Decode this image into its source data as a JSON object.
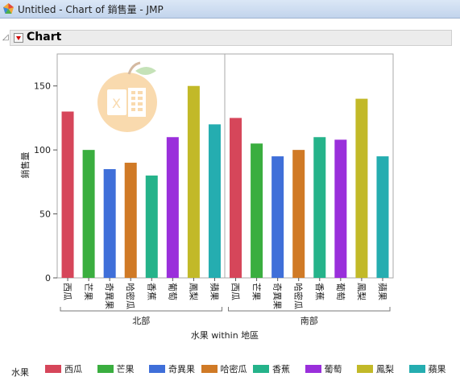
{
  "window": {
    "title": "Untitled - Chart of 銷售量 - JMP"
  },
  "outline": {
    "title": "Chart"
  },
  "chart_data": {
    "type": "bar",
    "ylabel": "銷售量",
    "xlabel": "水果 within 地區",
    "ylim": [
      0,
      175
    ],
    "yticks": [
      0,
      50,
      100,
      150
    ],
    "groups": [
      {
        "name": "北部",
        "categories": [
          "西瓜",
          "芒果",
          "奇異果",
          "哈密瓜",
          "香蕉",
          "葡萄",
          "鳳梨",
          "蘋果"
        ],
        "values": [
          130,
          100,
          85,
          90,
          80,
          110,
          150,
          120
        ]
      },
      {
        "name": "南部",
        "categories": [
          "西瓜",
          "芒果",
          "奇異果",
          "哈密瓜",
          "香蕉",
          "葡萄",
          "鳳梨",
          "蘋果"
        ],
        "values": [
          125,
          105,
          95,
          100,
          110,
          108,
          140,
          95
        ]
      }
    ],
    "colors": {
      "西瓜": "#d6465a",
      "芒果": "#3aae3f",
      "奇異果": "#3f6fd9",
      "哈密瓜": "#d07a26",
      "香蕉": "#25b38a",
      "葡萄": "#9a2fdb",
      "鳳梨": "#c2b928",
      "蘋果": "#25adb0"
    },
    "legend": {
      "title": "水果",
      "position": "bottom",
      "items": [
        "西瓜",
        "芒果",
        "奇異果",
        "哈密瓜",
        "香蕉",
        "葡萄",
        "鳳梨",
        "蘋果"
      ]
    },
    "grid": false
  }
}
